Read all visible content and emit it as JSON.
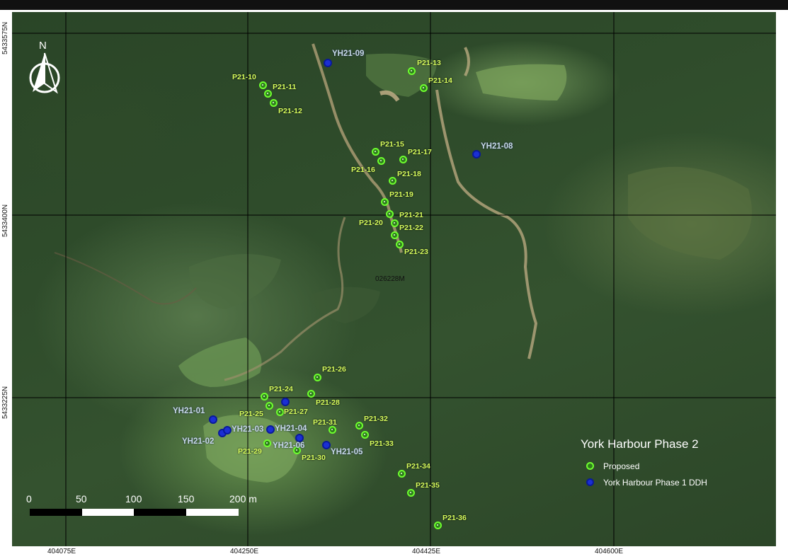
{
  "map": {
    "title": "York Harbour Phase 2",
    "claim_label": "026228M",
    "north_label": "N",
    "y_coord_labels": [
      "5433575N",
      "5433400N",
      "5433225N"
    ],
    "x_coord_labels": [
      "404075E",
      "404250E",
      "404425E",
      "404600E"
    ]
  },
  "legend": {
    "title": "York Harbour Phase 2",
    "items": [
      {
        "label": "Proposed",
        "color": "#6eff2e",
        "icon": "proposed-hole-icon"
      },
      {
        "label": "York Harbour Phase 1 DDH",
        "color": "#1b2fd4",
        "icon": "ddh-hole-icon"
      }
    ]
  },
  "scale_bar": {
    "ticks": [
      "0",
      "50",
      "100",
      "150",
      "200 m"
    ]
  },
  "proposed_holes": [
    "P21-10",
    "P21-11",
    "P21-12",
    "P21-13",
    "P21-14",
    "P21-15",
    "P21-16",
    "P21-17",
    "P21-18",
    "P21-19",
    "P21-20",
    "P21-21",
    "P21-22",
    "P21-23",
    "P21-24",
    "P21-25",
    "P21-26",
    "P21-27",
    "P21-28",
    "P21-29",
    "P21-30",
    "P21-31",
    "P21-32",
    "P21-33",
    "P21-34",
    "P21-35",
    "P21-36"
  ],
  "ddh_holes": [
    "YH21-01",
    "YH21-02",
    "YH21-03",
    "YH21-04",
    "YH21-05",
    "YH21-06",
    "YH21-08",
    "YH21-09"
  ],
  "colors": {
    "proposed": "#6eff2e",
    "ddh": "#1b2fd4",
    "proposed_label": "#d9ff5e",
    "ddh_label": "#c8d8e8",
    "grid": "#000000"
  }
}
